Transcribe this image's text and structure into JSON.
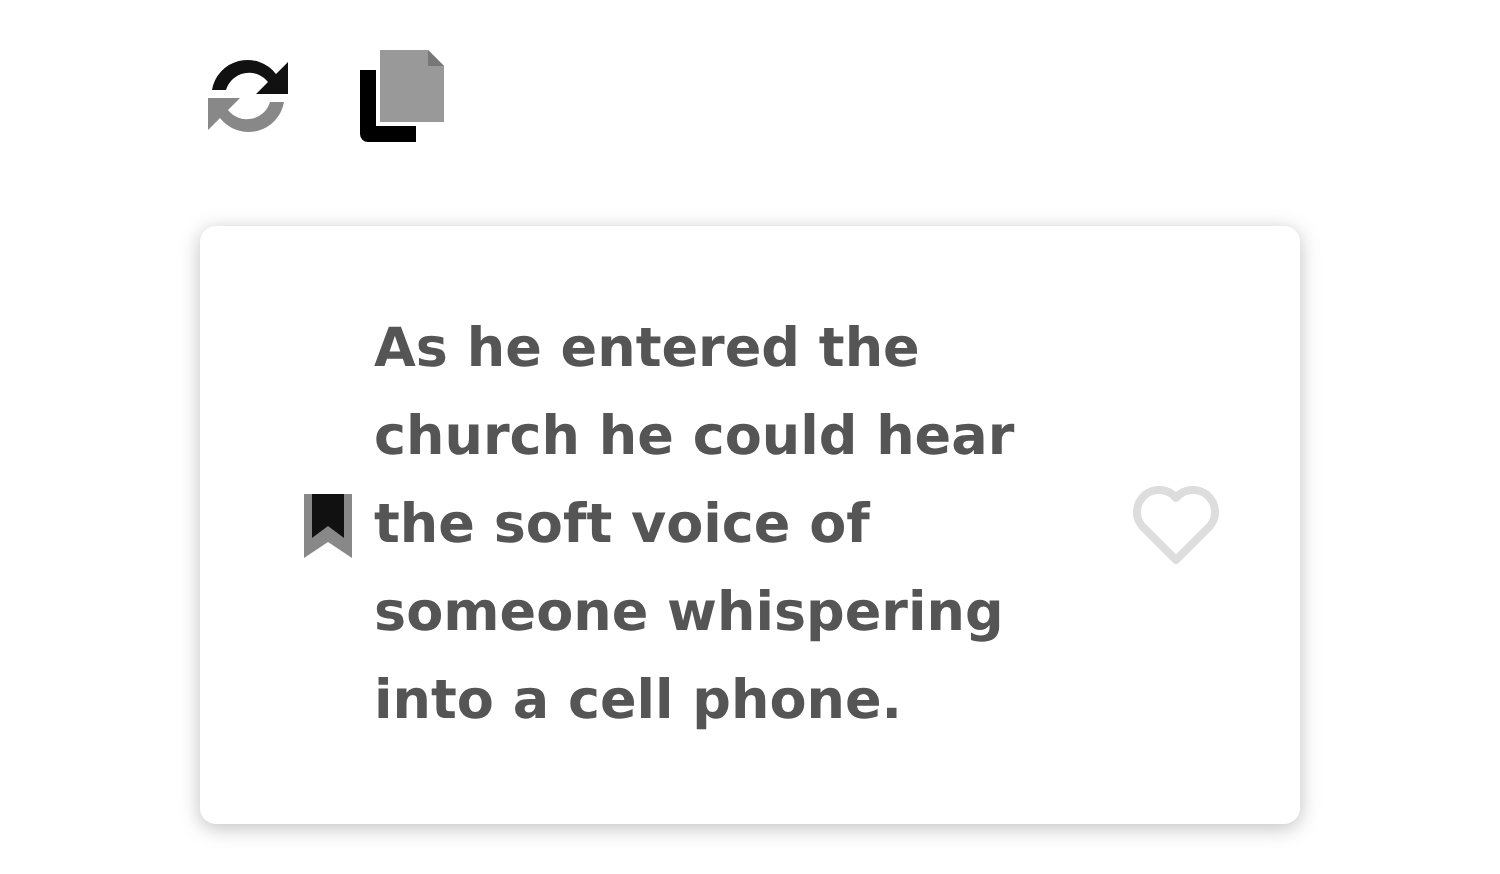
{
  "quote_card": {
    "text": "As he entered the church he could hear the soft voice of someone whispering into a cell phone.",
    "liked": false
  }
}
